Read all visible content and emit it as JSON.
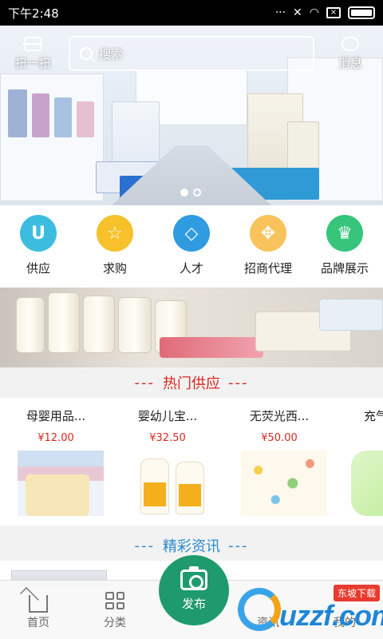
{
  "status_bar": {
    "time": "下午2:48"
  },
  "header": {
    "scan_label": "扫一扫",
    "search_placeholder": "搜索",
    "message_label": "消息"
  },
  "categories": [
    {
      "label": "供应",
      "icon": "u-icon",
      "color": "#3cbde0",
      "glyph": "U"
    },
    {
      "label": "求购",
      "icon": "star-icon",
      "color": "#f6c12a",
      "glyph": "☆"
    },
    {
      "label": "人才",
      "icon": "diamond-icon",
      "color": "#2f9be0",
      "glyph": "◇"
    },
    {
      "label": "招商代理",
      "icon": "arrows-icon",
      "color": "#f7c35a",
      "glyph": "✥"
    },
    {
      "label": "品牌展示",
      "icon": "crown-icon",
      "color": "#36c57a",
      "glyph": "♛"
    }
  ],
  "hot_supply": {
    "title": "热门供应",
    "items": [
      {
        "name": "母婴用品...",
        "price": "¥12.00"
      },
      {
        "name": "婴幼儿宝...",
        "price": "¥32.50"
      },
      {
        "name": "无荧光西...",
        "price": "¥50.00"
      },
      {
        "name": "充气",
        "price": ""
      }
    ]
  },
  "news": {
    "title": "精彩资讯"
  },
  "tab_bar": {
    "home": "首页",
    "category": "分类",
    "publish": "发布",
    "news": "资讯",
    "mine": "我的"
  },
  "watermark": {
    "text": "uzzf.com",
    "badge": "东坡下载"
  },
  "colors": {
    "accent_green": "#1f9a6c",
    "price_red": "#d9281e",
    "news_blue": "#2a8bd0"
  }
}
